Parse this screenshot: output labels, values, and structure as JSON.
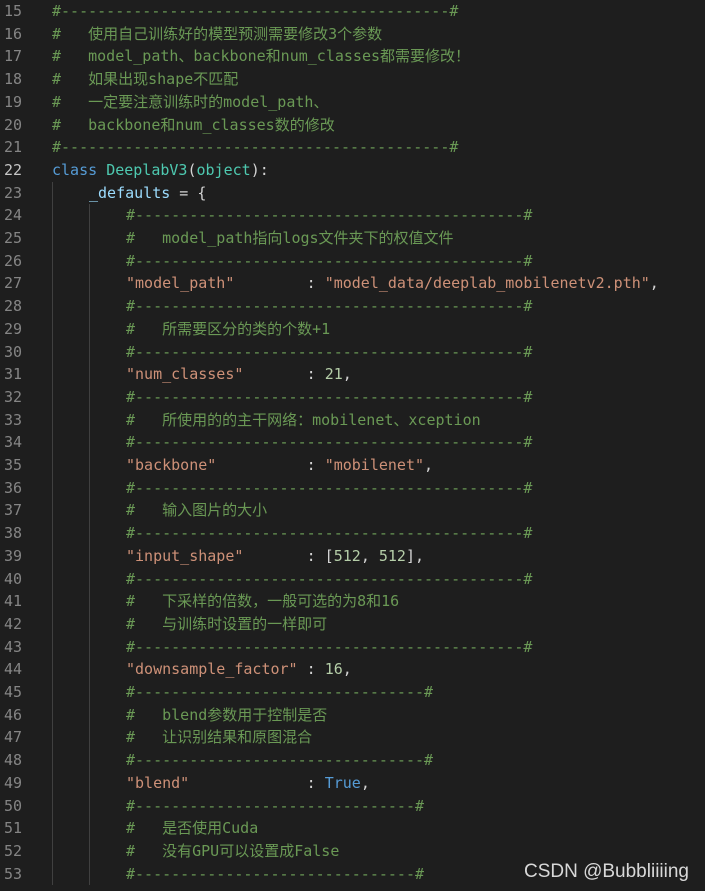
{
  "editor": {
    "active_line": "22",
    "lines": [
      {
        "n": "15",
        "i": 0,
        "t": [
          [
            "cmt",
            "#-------------------------------------------#"
          ]
        ]
      },
      {
        "n": "16",
        "i": 0,
        "t": [
          [
            "cmt",
            "#   使用自己训练好的模型预测需要修改3个参数"
          ]
        ]
      },
      {
        "n": "17",
        "i": 0,
        "t": [
          [
            "cmt",
            "#   model_path、backbone和num_classes都需要修改！"
          ]
        ]
      },
      {
        "n": "18",
        "i": 0,
        "t": [
          [
            "cmt",
            "#   如果出现shape不匹配"
          ]
        ]
      },
      {
        "n": "19",
        "i": 0,
        "t": [
          [
            "cmt",
            "#   一定要注意训练时的model_path、"
          ]
        ]
      },
      {
        "n": "20",
        "i": 0,
        "t": [
          [
            "cmt",
            "#   backbone和num_classes数的修改"
          ]
        ]
      },
      {
        "n": "21",
        "i": 0,
        "t": [
          [
            "cmt",
            "#-------------------------------------------#"
          ]
        ]
      },
      {
        "n": "22",
        "i": 0,
        "t": [
          [
            "kw",
            "class "
          ],
          [
            "cls",
            "DeeplabV3"
          ],
          [
            "plain",
            "("
          ],
          [
            "cls",
            "object"
          ],
          [
            "plain",
            "):"
          ]
        ]
      },
      {
        "n": "23",
        "i": 1,
        "t": [
          [
            "var",
            "_defaults"
          ],
          [
            "plain",
            " = {"
          ]
        ]
      },
      {
        "n": "24",
        "i": 2,
        "t": [
          [
            "cmt",
            "#-------------------------------------------#"
          ]
        ]
      },
      {
        "n": "25",
        "i": 2,
        "t": [
          [
            "cmt",
            "#   model_path指向logs文件夹下的权值文件"
          ]
        ]
      },
      {
        "n": "26",
        "i": 2,
        "t": [
          [
            "cmt",
            "#-------------------------------------------#"
          ]
        ]
      },
      {
        "n": "27",
        "i": 2,
        "t": [
          [
            "str",
            "\"model_path\""
          ],
          [
            "plain",
            "        : "
          ],
          [
            "str",
            "\"model_data/deeplab_mobilenetv2.pth\""
          ],
          [
            "plain",
            ","
          ]
        ]
      },
      {
        "n": "28",
        "i": 2,
        "t": [
          [
            "cmt",
            "#-------------------------------------------#"
          ]
        ]
      },
      {
        "n": "29",
        "i": 2,
        "t": [
          [
            "cmt",
            "#   所需要区分的类的个数+1"
          ]
        ]
      },
      {
        "n": "30",
        "i": 2,
        "t": [
          [
            "cmt",
            "#-------------------------------------------#"
          ]
        ]
      },
      {
        "n": "31",
        "i": 2,
        "t": [
          [
            "str",
            "\"num_classes\""
          ],
          [
            "plain",
            "       : "
          ],
          [
            "num",
            "21"
          ],
          [
            "plain",
            ","
          ]
        ]
      },
      {
        "n": "32",
        "i": 2,
        "t": [
          [
            "cmt",
            "#-------------------------------------------#"
          ]
        ]
      },
      {
        "n": "33",
        "i": 2,
        "t": [
          [
            "cmt",
            "#   所使用的的主干网络：mobilenet、xception"
          ]
        ]
      },
      {
        "n": "34",
        "i": 2,
        "t": [
          [
            "cmt",
            "#-------------------------------------------#"
          ]
        ]
      },
      {
        "n": "35",
        "i": 2,
        "t": [
          [
            "str",
            "\"backbone\""
          ],
          [
            "plain",
            "          : "
          ],
          [
            "str",
            "\"mobilenet\""
          ],
          [
            "plain",
            ","
          ]
        ]
      },
      {
        "n": "36",
        "i": 2,
        "t": [
          [
            "cmt",
            "#-------------------------------------------#"
          ]
        ]
      },
      {
        "n": "37",
        "i": 2,
        "t": [
          [
            "cmt",
            "#   输入图片的大小"
          ]
        ]
      },
      {
        "n": "38",
        "i": 2,
        "t": [
          [
            "cmt",
            "#-------------------------------------------#"
          ]
        ]
      },
      {
        "n": "39",
        "i": 2,
        "t": [
          [
            "str",
            "\"input_shape\""
          ],
          [
            "plain",
            "       : ["
          ],
          [
            "num",
            "512"
          ],
          [
            "plain",
            ", "
          ],
          [
            "num",
            "512"
          ],
          [
            "plain",
            "],"
          ]
        ]
      },
      {
        "n": "40",
        "i": 2,
        "t": [
          [
            "cmt",
            "#-------------------------------------------#"
          ]
        ]
      },
      {
        "n": "41",
        "i": 2,
        "t": [
          [
            "cmt",
            "#   下采样的倍数，一般可选的为8和16"
          ]
        ]
      },
      {
        "n": "42",
        "i": 2,
        "t": [
          [
            "cmt",
            "#   与训练时设置的一样即可"
          ]
        ]
      },
      {
        "n": "43",
        "i": 2,
        "t": [
          [
            "cmt",
            "#-------------------------------------------#"
          ]
        ]
      },
      {
        "n": "44",
        "i": 2,
        "t": [
          [
            "str",
            "\"downsample_factor\""
          ],
          [
            "plain",
            " : "
          ],
          [
            "num",
            "16"
          ],
          [
            "plain",
            ","
          ]
        ]
      },
      {
        "n": "45",
        "i": 2,
        "t": [
          [
            "cmt",
            "#--------------------------------#"
          ]
        ]
      },
      {
        "n": "46",
        "i": 2,
        "t": [
          [
            "cmt",
            "#   blend参数用于控制是否"
          ]
        ]
      },
      {
        "n": "47",
        "i": 2,
        "t": [
          [
            "cmt",
            "#   让识别结果和原图混合"
          ]
        ]
      },
      {
        "n": "48",
        "i": 2,
        "t": [
          [
            "cmt",
            "#--------------------------------#"
          ]
        ]
      },
      {
        "n": "49",
        "i": 2,
        "t": [
          [
            "str",
            "\"blend\""
          ],
          [
            "plain",
            "             : "
          ],
          [
            "bool",
            "True"
          ],
          [
            "plain",
            ","
          ]
        ]
      },
      {
        "n": "50",
        "i": 2,
        "t": [
          [
            "cmt",
            "#-------------------------------#"
          ]
        ]
      },
      {
        "n": "51",
        "i": 2,
        "t": [
          [
            "cmt",
            "#   是否使用Cuda"
          ]
        ]
      },
      {
        "n": "52",
        "i": 2,
        "t": [
          [
            "cmt",
            "#   没有GPU可以设置成False"
          ]
        ]
      },
      {
        "n": "53",
        "i": 2,
        "t": [
          [
            "cmt",
            "#-------------------------------#"
          ]
        ]
      }
    ]
  },
  "watermark": "CSDN @Bubbliiiing"
}
